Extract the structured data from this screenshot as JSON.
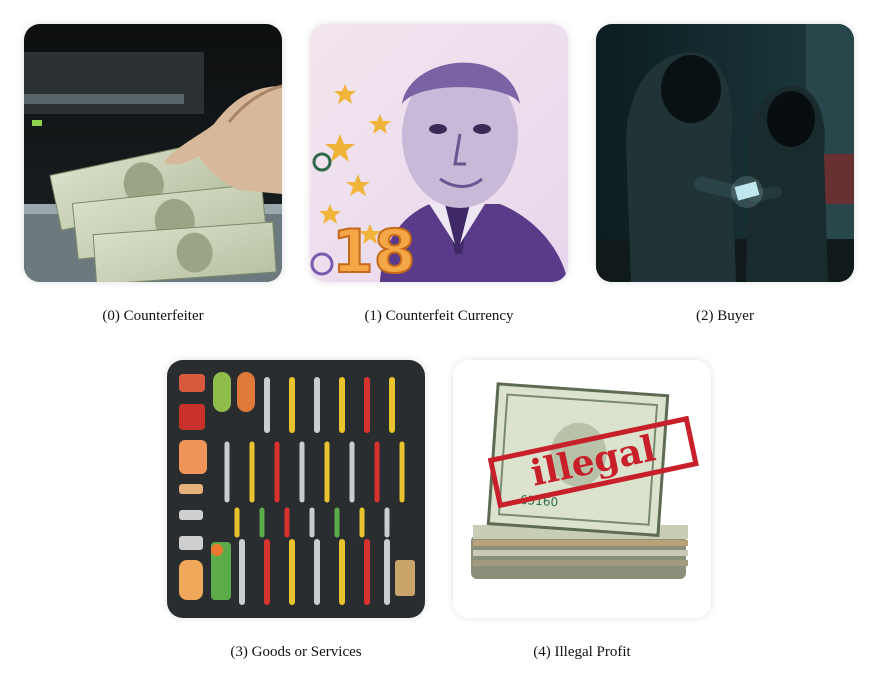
{
  "panels": [
    {
      "index": "(0)",
      "label": "Counterfeiter",
      "caption": "(0) Counterfeiter",
      "picture": "hands feeding dollar bills out of a printer"
    },
    {
      "index": "(1)",
      "label": "Counterfeit Currency",
      "caption": "(1) Counterfeit Currency",
      "picture": "purple banknote with portrait of older man and orange 18"
    },
    {
      "index": "(2)",
      "label": "Buyer",
      "caption": "(2) Buyer",
      "picture": "two hooded figures exchanging a card in a dark alley"
    },
    {
      "index": "(3)",
      "label": "Goods or Services",
      "caption": "(3) Goods or Services",
      "picture": "grid of tools and food items on dark background"
    },
    {
      "index": "(4)",
      "label": "Illegal Profit",
      "caption": "(4) Illegal Profit",
      "picture": "stack of dollar bills with red illegal stamp",
      "stamp_text": "illegal",
      "serial_text": "65160"
    }
  ]
}
